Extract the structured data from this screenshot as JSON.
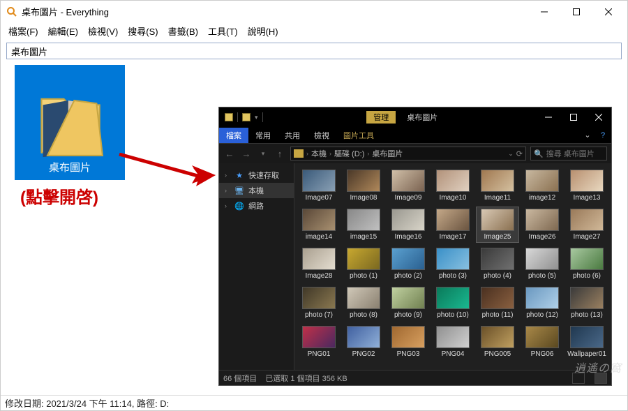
{
  "everything": {
    "title": "桌布圖片 - Everything",
    "menus": [
      "檔案(F)",
      "編輯(E)",
      "檢視(V)",
      "搜尋(S)",
      "書籤(B)",
      "工具(T)",
      "說明(H)"
    ],
    "search_value": "桌布圖片",
    "status": "修改日期: 2021/3/24 下午 11:14, 路徑: D:"
  },
  "folder": {
    "caption": "桌布圖片",
    "hint": "(點擊開啓)"
  },
  "explorer": {
    "manage_tag": "管理",
    "title_text": "桌布圖片",
    "tabs": {
      "file": "檔案",
      "home": "常用",
      "share": "共用",
      "view": "檢視",
      "pic_tools": "圖片工具"
    },
    "help": "?",
    "breadcrumb": [
      "本機",
      "驅碟 (D:)",
      "桌布圖片"
    ],
    "search_placeholder": "搜尋 桌布圖片",
    "nav": {
      "quick": "快速存取",
      "pc": "本機",
      "net": "網路"
    },
    "status": {
      "count": "66 個項目",
      "selection": "已選取 1 個項目  356 KB"
    },
    "items": [
      {
        "n": "Image07",
        "c1": "#3a5a7a",
        "c2": "#8aa0b4"
      },
      {
        "n": "Image08",
        "c1": "#4a3828",
        "c2": "#b0885a"
      },
      {
        "n": "Image09",
        "c1": "#d0bfa8",
        "c2": "#7a6250"
      },
      {
        "n": "Image10",
        "c1": "#b2927a",
        "c2": "#e0d0c0"
      },
      {
        "n": "Image11",
        "c1": "#a07850",
        "c2": "#d4c0a0"
      },
      {
        "n": "image12",
        "c1": "#c8b8a0",
        "c2": "#8a7050"
      },
      {
        "n": "Image13",
        "c1": "#b89070",
        "c2": "#e8d8c0"
      },
      {
        "n": "image14",
        "c1": "#5a4838",
        "c2": "#a89070"
      },
      {
        "n": "image15",
        "c1": "#888888",
        "c2": "#c0c0c0"
      },
      {
        "n": "Image16",
        "c1": "#9a9890",
        "c2": "#d8d4c8"
      },
      {
        "n": "Image17",
        "c1": "#c4a888",
        "c2": "#6a5440"
      },
      {
        "n": "Image25",
        "c1": "#d8c8b4",
        "c2": "#8a7050",
        "sel": true
      },
      {
        "n": "Image26",
        "c1": "#cab8a0",
        "c2": "#7e6850"
      },
      {
        "n": "Image27",
        "c1": "#9a7a5a",
        "c2": "#d0b898"
      },
      {
        "n": "Image28",
        "c1": "#aaa090",
        "c2": "#e4ddd0"
      },
      {
        "n": "photo (1)",
        "c1": "#c8a830",
        "c2": "#7a6820"
      },
      {
        "n": "photo (2)",
        "c1": "#5aa0d0",
        "c2": "#2a6090"
      },
      {
        "n": "photo (3)",
        "c1": "#3a90c8",
        "c2": "#88c0e0"
      },
      {
        "n": "photo (4)",
        "c1": "#3a3a3a",
        "c2": "#707070"
      },
      {
        "n": "photo (5)",
        "c1": "#d8d8d8",
        "c2": "#909090"
      },
      {
        "n": "photo (6)",
        "c1": "#a8c8a0",
        "c2": "#4a7a40"
      },
      {
        "n": "photo (7)",
        "c1": "#403828",
        "c2": "#8a7850"
      },
      {
        "n": "photo (8)",
        "c1": "#d0c8b8",
        "c2": "#8a8070"
      },
      {
        "n": "photo (9)",
        "c1": "#c0d0a0",
        "c2": "#708050"
      },
      {
        "n": "photo (10)",
        "c1": "#0a7a5a",
        "c2": "#1ab890"
      },
      {
        "n": "photo (11)",
        "c1": "#4a3020",
        "c2": "#8a6040"
      },
      {
        "n": "photo (12)",
        "c1": "#6a98c0",
        "c2": "#b0d0e8"
      },
      {
        "n": "photo (13)",
        "c1": "#3a3a3a",
        "c2": "#9a8060"
      },
      {
        "n": "PNG01",
        "c1": "#c03048",
        "c2": "#4a2860"
      },
      {
        "n": "PNG02",
        "c1": "#4060a0",
        "c2": "#90b0d8"
      },
      {
        "n": "PNG03",
        "c1": "#a06830",
        "c2": "#d8a060"
      },
      {
        "n": "PNG04",
        "c1": "#909090",
        "c2": "#d0d0d0"
      },
      {
        "n": "PNG005",
        "c1": "#6a5028",
        "c2": "#c0a060"
      },
      {
        "n": "PNG06",
        "c1": "#a88848",
        "c2": "#5a4820"
      },
      {
        "n": "Wallpaper01",
        "c1": "#203850",
        "c2": "#4a6888"
      }
    ]
  },
  "watermark": "逍遙の窩"
}
